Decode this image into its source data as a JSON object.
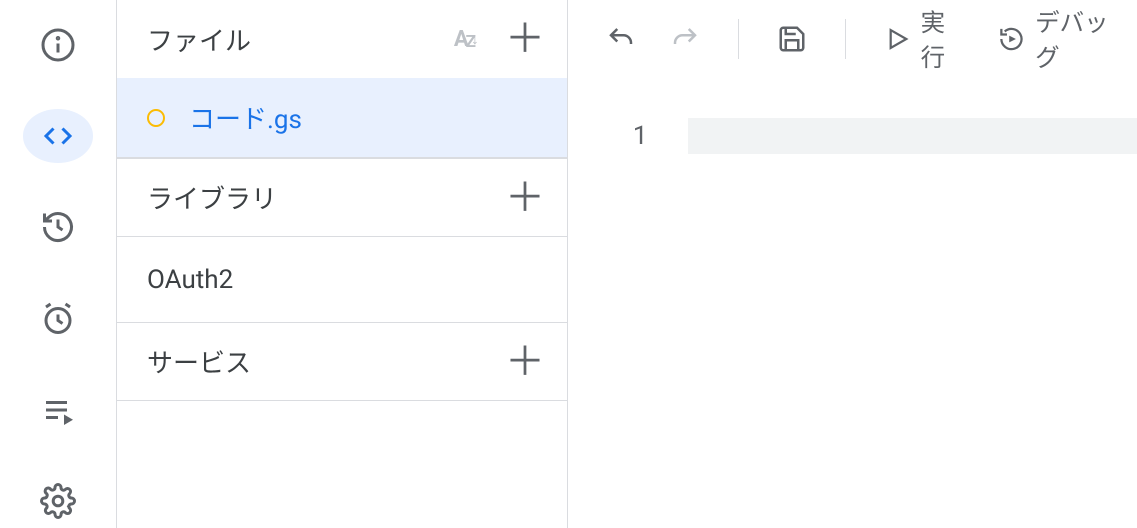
{
  "rail": {
    "items": [
      "info",
      "editor",
      "history",
      "triggers",
      "executions",
      "settings"
    ]
  },
  "files": {
    "section_label": "ファイル",
    "file_name": "コード.gs",
    "library_label": "ライブラリ",
    "library_item": "OAuth2",
    "services_label": "サービス"
  },
  "toolbar": {
    "run_label": "実行",
    "debug_label": "デバッグ"
  },
  "editor": {
    "line_number": "1"
  }
}
